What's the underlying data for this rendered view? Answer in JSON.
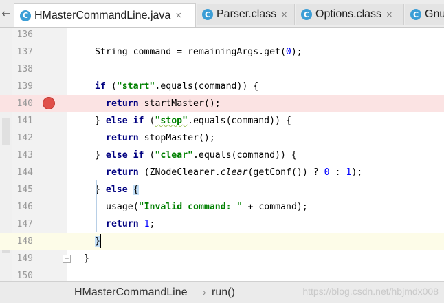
{
  "tabs": [
    {
      "label": "HMasterCommandLine.java",
      "icon": "c-class-icon",
      "icon_letter": "C",
      "close": "×",
      "active": true
    },
    {
      "label": "Parser.class",
      "icon": "c-class-icon",
      "icon_letter": "C",
      "close": "×",
      "active": false
    },
    {
      "label": "Options.class",
      "icon": "c-class-icon",
      "icon_letter": "C",
      "close": "×",
      "active": false
    },
    {
      "label": "Gnu",
      "icon": "c-class-icon",
      "icon_letter": "C",
      "close": "",
      "active": false
    }
  ],
  "nav_left": "←",
  "editor": {
    "line_numbers": [
      "136",
      "137",
      "138",
      "139",
      "140",
      "141",
      "142",
      "143",
      "144",
      "145",
      "146",
      "147",
      "148",
      "149",
      "150"
    ],
    "breakpoint_line": "140",
    "caret_line": "148",
    "code": {
      "l137": {
        "a": "String command = remainingArgs.get(",
        "n": "0",
        "b": ");"
      },
      "l139": {
        "kw": "if",
        "a": " (",
        "s": "\"start\"",
        "b": ".equals(command)) {"
      },
      "l140": {
        "kw": "return",
        "a": " startMaster();"
      },
      "l141": {
        "a": "} ",
        "kw1": "else",
        "sp": " ",
        "kw2": "if",
        "b": " (",
        "s": "\"stop\"",
        "c": ".equals(command)) {"
      },
      "l142": {
        "kw": "return",
        "a": " stopMaster();"
      },
      "l143": {
        "a": "} ",
        "kw1": "else",
        "sp": " ",
        "kw2": "if",
        "b": " (",
        "s": "\"clear\"",
        "c": ".equals(command)) {"
      },
      "l144": {
        "kw": "return",
        "a": " (ZNodeClearer.",
        "it": "clear",
        "b": "(getConf()) ? ",
        "n1": "0",
        "c": " : ",
        "n2": "1",
        "d": ");"
      },
      "l145": {
        "a": "} ",
        "kw": "else",
        "sp": " ",
        "brace": "{"
      },
      "l146": {
        "a": "usage(",
        "s": "\"Invalid command: \"",
        "b": " + command);"
      },
      "l147": {
        "kw": "return",
        "sp": " ",
        "n": "1",
        "b": ";"
      },
      "l148": {
        "brace": "}"
      },
      "l149": {
        "a": "}"
      }
    }
  },
  "breadcrumb": {
    "items": [
      "HMasterCommandLine",
      "run()"
    ],
    "separator": "›"
  },
  "watermark": "https://blog.csdn.net/hbjmdx008",
  "colors": {
    "keyword": "#000080",
    "string": "#008000",
    "number": "#0000ff",
    "breakpoint": "#e0504a",
    "breakpoint_line_bg": "#fbe3e3",
    "caret_line_bg": "#fdfce8",
    "class_icon": "#3c9ed6"
  }
}
